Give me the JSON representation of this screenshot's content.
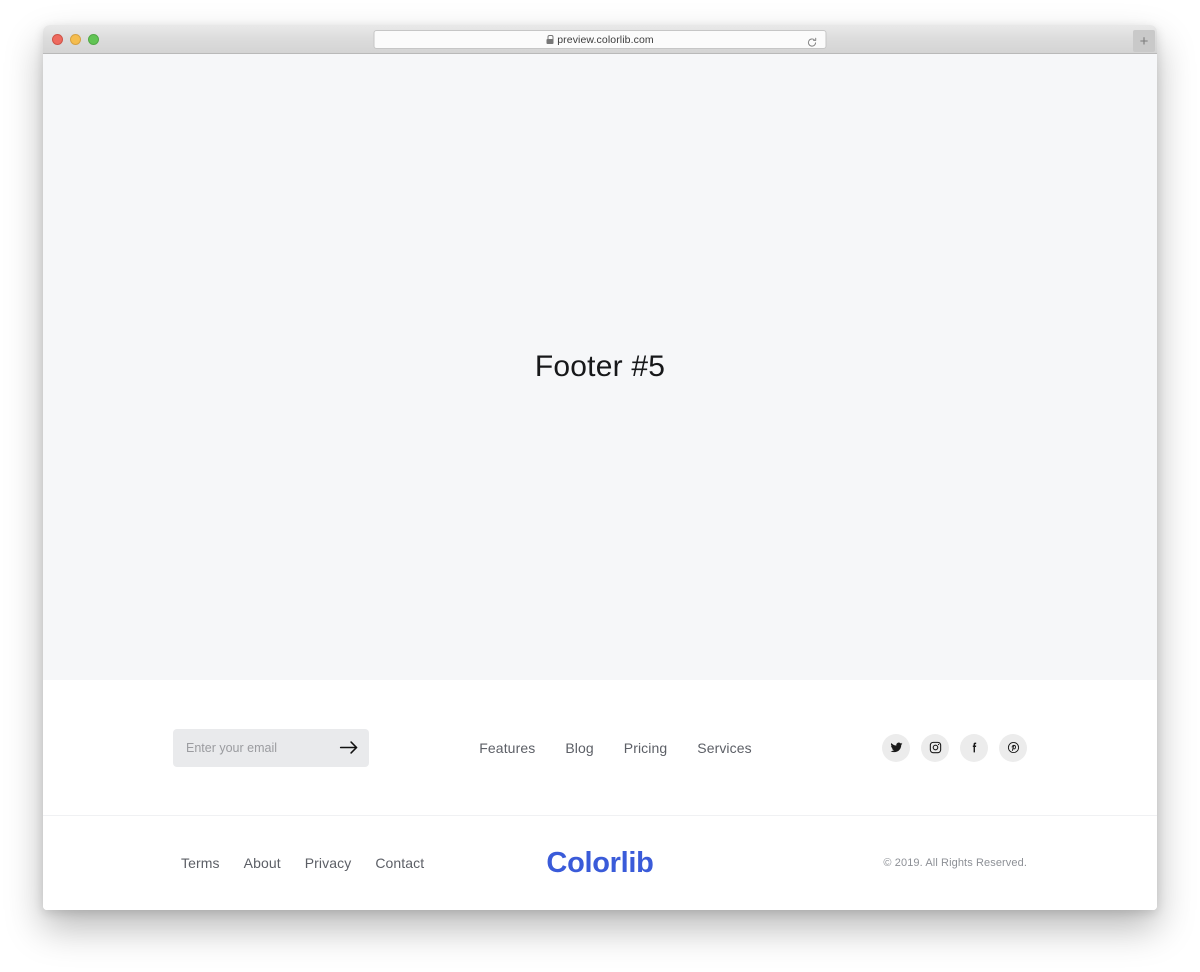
{
  "browser": {
    "url": "preview.colorlib.com",
    "lock_icon": "lock-icon",
    "reload_icon": "reload-icon",
    "new_tab_label": "+",
    "traffic_lights": [
      "close",
      "minimize",
      "maximize"
    ]
  },
  "hero": {
    "title": "Footer #5"
  },
  "footer": {
    "subscribe": {
      "placeholder": "Enter your email",
      "value": "",
      "submit_icon": "arrow-right-icon"
    },
    "nav": [
      {
        "label": "Features"
      },
      {
        "label": "Blog"
      },
      {
        "label": "Pricing"
      },
      {
        "label": "Services"
      }
    ],
    "social": [
      {
        "name": "twitter",
        "icon": "twitter-icon"
      },
      {
        "name": "instagram",
        "icon": "instagram-icon"
      },
      {
        "name": "facebook",
        "icon": "facebook-icon"
      },
      {
        "name": "pinterest",
        "icon": "pinterest-icon"
      }
    ],
    "legal_nav": [
      {
        "label": "Terms"
      },
      {
        "label": "About"
      },
      {
        "label": "Privacy"
      },
      {
        "label": "Contact"
      }
    ],
    "brand": "Colorlib",
    "copyright": "© 2019. All Rights Reserved.",
    "colors": {
      "brand": "#3a5bd9",
      "hero_bg": "#f6f7f9",
      "input_bg": "#e9eaec",
      "social_bg": "#ececec",
      "link": "#5c5f66"
    }
  }
}
